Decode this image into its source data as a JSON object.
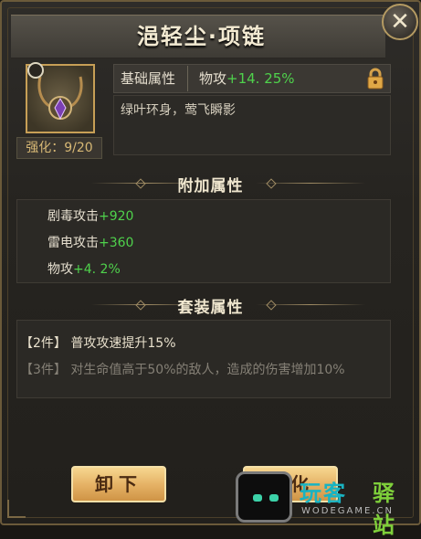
{
  "window": {
    "title": "浥轻尘·项链",
    "close_icon": "close-icon"
  },
  "item": {
    "icon": "necklace-icon",
    "enhance_label": "强化：9/20"
  },
  "base_attr": {
    "label": "基础属性",
    "stat_name": "物攻",
    "stat_value": "+14. 25%",
    "lock_icon": "lock-icon",
    "description": "绿叶环身，莺飞瞬影"
  },
  "extra_attr": {
    "title": "附加属性",
    "rows": [
      {
        "name": "剧毒攻击",
        "value": "+920"
      },
      {
        "name": "雷电攻击",
        "value": "+360"
      },
      {
        "name": "物攻",
        "value": "+4. 2%"
      }
    ]
  },
  "set_attr": {
    "title": "套装属性",
    "rows": [
      {
        "tag": "【2件】",
        "text": "普攻攻速提升15%",
        "active": true
      },
      {
        "tag": "【3件】",
        "text": "对生命值高于50%的敌人，造成的伤害增加10%",
        "active": false
      }
    ]
  },
  "buttons": {
    "unequip": "卸下",
    "enhance": "强化"
  },
  "watermark": {
    "text_a": "玩客",
    "text_b": "驿站",
    "sub": "WODEGAME.CN"
  },
  "colors": {
    "green": "#4fd24c",
    "gold": "#c79f56"
  }
}
